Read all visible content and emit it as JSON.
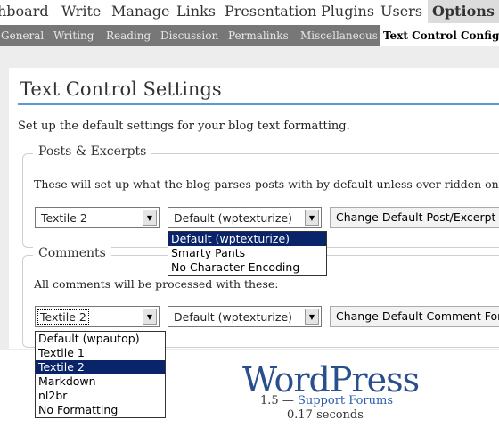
{
  "menu": {
    "items": [
      {
        "label": "hboard"
      },
      {
        "label": "Write"
      },
      {
        "label": "Manage"
      },
      {
        "label": "Links"
      },
      {
        "label": "Presentation"
      },
      {
        "label": "Plugins"
      },
      {
        "label": "Users"
      },
      {
        "label": "Options",
        "current": true
      }
    ]
  },
  "submenu": {
    "items": [
      {
        "label": "General"
      },
      {
        "label": "Writing"
      },
      {
        "label": "Reading"
      },
      {
        "label": "Discussion"
      },
      {
        "label": "Permalinks"
      },
      {
        "label": "Miscellaneous"
      },
      {
        "label": "Text Control Config",
        "current": true
      }
    ]
  },
  "page": {
    "title": "Text Control Settings",
    "intro": "Set up the default settings for your blog text formatting."
  },
  "posts": {
    "legend": "Posts & Excerpts",
    "description": "These will set up what the blog parses posts with by default unless over ridden on a p",
    "format_select": {
      "value": "Textile 2"
    },
    "encoding_select": {
      "value": "Default (wptexturize)"
    },
    "button": "Change Default Post/Excerpt",
    "encoding_options": [
      "Default (wptexturize)",
      "Smarty Pants",
      "No Character Encoding"
    ]
  },
  "comments": {
    "legend": "Comments",
    "description": "All comments will be processed with these:",
    "format_select": {
      "value": "Textile 2"
    },
    "encoding_select": {
      "value": "Default (wptexturize)"
    },
    "button": "Change Default Comment For",
    "format_options": [
      "Default (wpautop)",
      "Textile 1",
      "Textile 2",
      "Markdown",
      "nl2br",
      "No Formatting"
    ]
  },
  "footer": {
    "logo": "WordPress",
    "version": "1.5",
    "separator": " — ",
    "support_link": "Support Forums",
    "timer": "0.17 seconds"
  },
  "colors": {
    "submenu_bg": "#777777",
    "content_bg": "#ededed",
    "title_rule": "#5c9bd1",
    "highlight": "#0a246a",
    "logo": "#2a4f8d"
  }
}
